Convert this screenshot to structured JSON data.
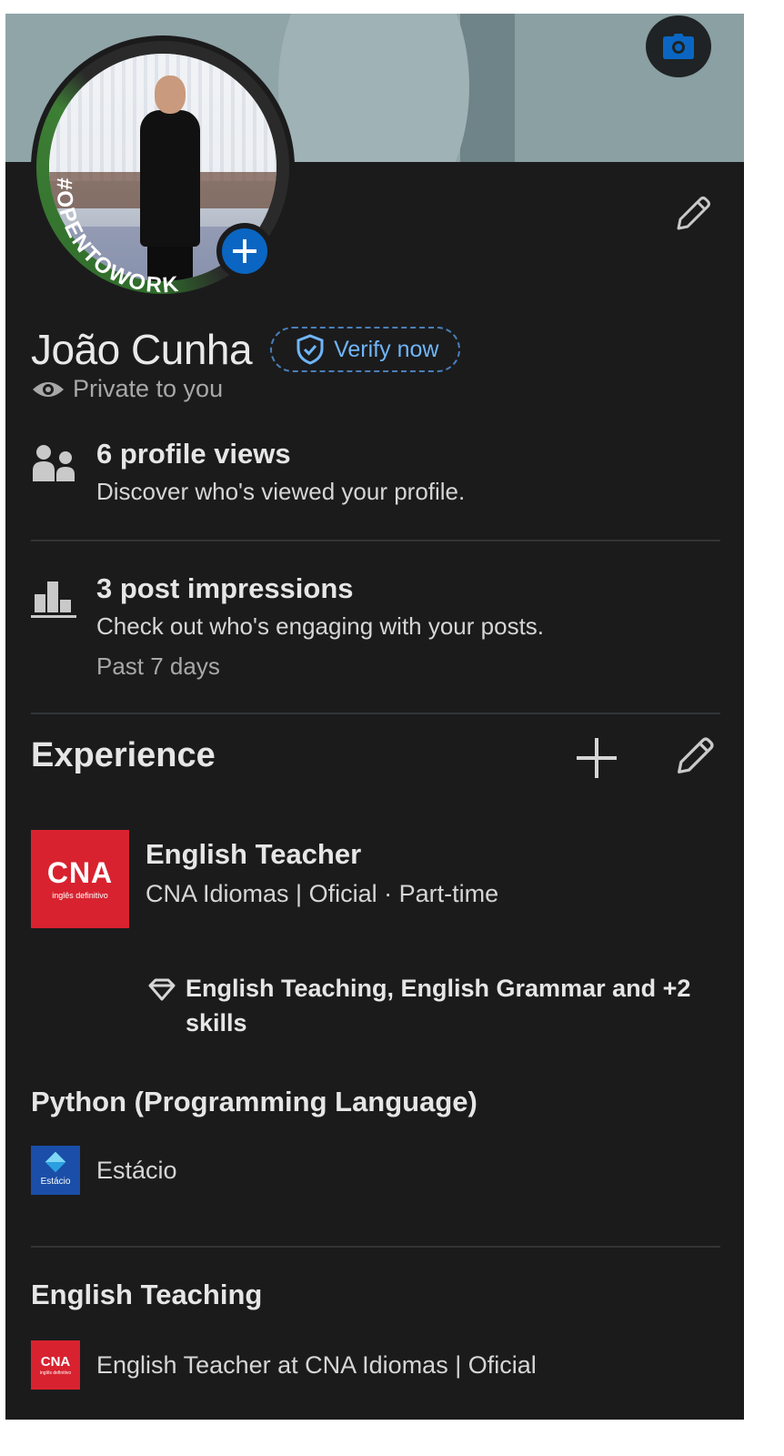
{
  "profile": {
    "name": "João Cunha",
    "verify_label": "Verify now",
    "privacy_label": "Private to you",
    "open_to_work_frame_text": "#OPENTOWORK"
  },
  "analytics": {
    "profile_views": {
      "title": "6 profile views",
      "description": "Discover who's viewed your profile."
    },
    "post_impressions": {
      "title": "3 post impressions",
      "description": "Check out who's engaging with your posts.",
      "period": "Past 7 days"
    }
  },
  "experience": {
    "header": "Experience",
    "items": [
      {
        "title": "English Teacher",
        "company_line": "CNA Idiomas | Oficial · Part-time",
        "logo_text": "CNA",
        "logo_subtext": "inglês definitivo",
        "skills": "English Teaching, English Grammar and +2 skills"
      }
    ]
  },
  "skills": [
    {
      "name": "Python (Programming Language)",
      "source": "Estácio",
      "logo_text": "Estácio"
    },
    {
      "name": "English Teaching",
      "source": "English Teacher at CNA Idiomas | Oficial",
      "logo_text": "CNA",
      "logo_subtext": "inglês definitivo"
    }
  ],
  "colors": {
    "background": "#1b1b1c",
    "accent_blue": "#0a66c2",
    "link_blue": "#70b5f9",
    "open_to_work_green": "#3d7e35",
    "cna_red": "#d8222f",
    "estacio_blue": "#1a4ea8"
  },
  "icons": {
    "camera": "camera-icon",
    "add_photo": "plus-icon",
    "edit": "pencil-icon",
    "verify": "shield-check-icon",
    "privacy": "eye-icon",
    "profile_views": "people-icon",
    "impressions": "bar-chart-icon",
    "add": "plus-icon",
    "skills": "diamond-icon"
  }
}
